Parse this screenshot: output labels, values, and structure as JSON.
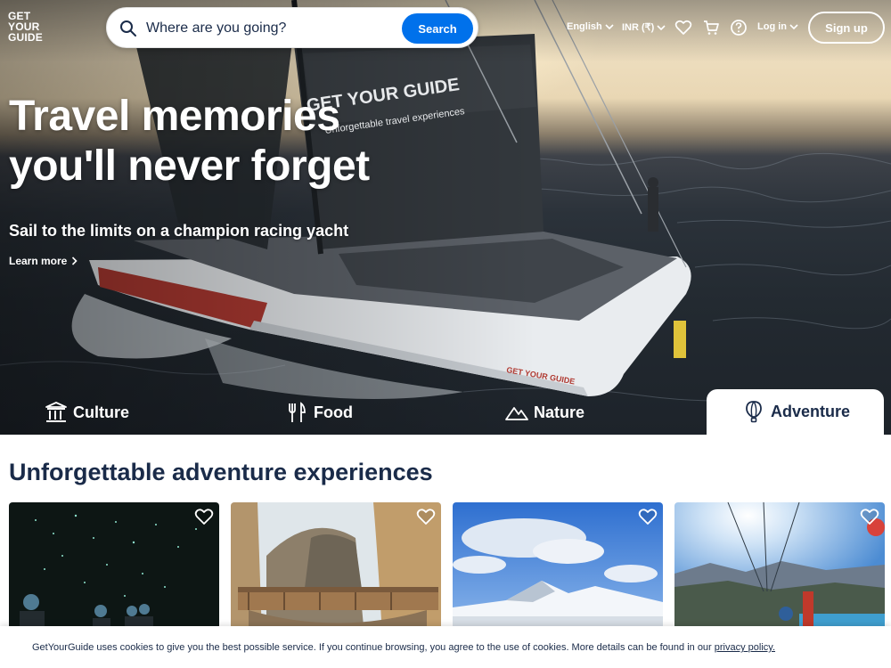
{
  "header": {
    "logo_lines": [
      "GET",
      "YOUR",
      "GUIDE"
    ],
    "search": {
      "placeholder": "Where are you going?",
      "button_label": "Search"
    },
    "language_label": "English",
    "currency_label": "INR (₹)",
    "login_label": "Log in",
    "signup_label": "Sign up",
    "icons": [
      "search-icon",
      "heart-icon",
      "cart-icon",
      "help-icon",
      "chevron-down-icon"
    ]
  },
  "hero": {
    "title_line1": "Travel memories",
    "title_line2": "you'll never forget",
    "subtitle": "Sail to the limits on a champion racing yacht",
    "cta_label": "Learn more",
    "sail_branding": "GET YOUR GUIDE",
    "sail_tagline": "Unforgettable travel experiences",
    "hull_branding": "GET YOUR GUIDE"
  },
  "categories": [
    {
      "label": "Culture",
      "icon": "temple-icon",
      "active": false
    },
    {
      "label": "Food",
      "icon": "fork-knife-icon",
      "active": false
    },
    {
      "label": "Nature",
      "icon": "mountain-icon",
      "active": false
    },
    {
      "label": "Adventure",
      "icon": "hot-air-balloon-icon",
      "active": true
    }
  ],
  "main": {
    "section_title": "Unforgettable adventure experiences",
    "cards": [
      {
        "image": "glowworm-cave",
        "wishlist_icon": "heart-icon"
      },
      {
        "image": "cliff-walkway-bridge",
        "wishlist_icon": "heart-icon"
      },
      {
        "image": "snowy-mountains",
        "wishlist_icon": "heart-icon"
      },
      {
        "image": "paragliding-lake",
        "wishlist_icon": "heart-icon"
      }
    ]
  },
  "cookie_banner": {
    "text": "GetYourGuide uses cookies to give you the best possible service. If you continue browsing, you agree to the use of cookies. More details can be found in our",
    "link_label": "privacy policy."
  },
  "colors": {
    "brand_blue": "#0071eb",
    "navy_text": "#1a2b49",
    "white": "#ffffff"
  }
}
